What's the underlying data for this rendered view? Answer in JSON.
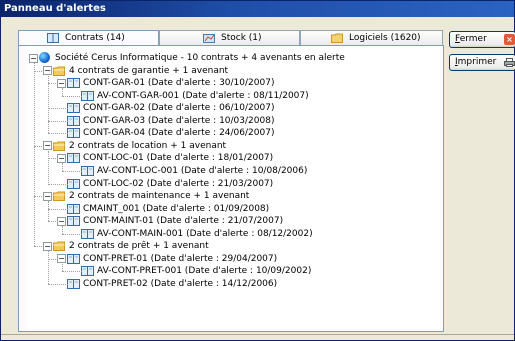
{
  "window": {
    "title": "Panneau d'alertes"
  },
  "tabs": [
    {
      "label": "Contrats (14)",
      "icon": "book-icon",
      "active": true
    },
    {
      "label": "Stock (1)",
      "icon": "stock-icon",
      "active": false
    },
    {
      "label": "Logiciels (1620)",
      "icon": "folder-icon",
      "active": false
    }
  ],
  "buttons": {
    "close_label_u": "F",
    "close_label_rest": "ermer",
    "print_label_u": "I",
    "print_label_rest": "mprimer"
  },
  "tree": {
    "root": "Société Cerus Informatique - 10 contrats + 4 avenants en alerte",
    "groups": [
      {
        "label": "4 contrats de garantie + 1 avenant",
        "items": [
          {
            "label": "CONT-GAR-01 (Date d'alerte : 30/10/2007)",
            "children": [
              "AV-CONT-GAR-001 (Date d'alerte : 08/11/2007)"
            ]
          },
          {
            "label": "CONT-GAR-02 (Date d'alerte : 06/10/2007)"
          },
          {
            "label": "CONT-GAR-03 (Date d'alerte : 10/03/2008)"
          },
          {
            "label": "CONT-GAR-04 (Date d'alerte : 24/06/2007)"
          }
        ]
      },
      {
        "label": "2 contrats de location + 1 avenant",
        "items": [
          {
            "label": "CONT-LOC-01 (Date d'alerte : 18/01/2007)",
            "children": [
              "AV-CONT-LOC-001 (Date d'alerte : 10/08/2006)"
            ]
          },
          {
            "label": "CONT-LOC-02 (Date d'alerte : 21/03/2007)"
          }
        ]
      },
      {
        "label": "2 contrats de maintenance + 1 avenant",
        "items": [
          {
            "label": "CMAINT_001 (Date d'alerte : 01/09/2008)"
          },
          {
            "label": "CONT-MAINT-01 (Date d'alerte : 21/07/2007)",
            "children": [
              "AV-CONT-MAIN-001 (Date d'alerte : 08/12/2002)"
            ]
          }
        ]
      },
      {
        "label": "2 contrats de prêt + 1 avenant",
        "items": [
          {
            "label": "CONT-PRET-01 (Date d'alerte : 29/04/2007)",
            "children": [
              "AV-CONT-PRET-001 (Date d'alerte : 10/09/2002)"
            ]
          },
          {
            "label": "CONT-PRET-02 (Date d'alerte : 14/12/2006)"
          }
        ]
      }
    ]
  }
}
